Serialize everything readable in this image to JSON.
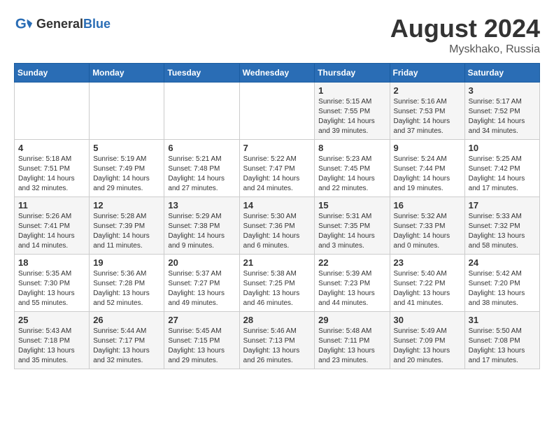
{
  "header": {
    "logo_general": "General",
    "logo_blue": "Blue",
    "title": "August 2024",
    "location": "Myskhako, Russia"
  },
  "weekdays": [
    "Sunday",
    "Monday",
    "Tuesday",
    "Wednesday",
    "Thursday",
    "Friday",
    "Saturday"
  ],
  "weeks": [
    [
      {
        "day": "",
        "info": ""
      },
      {
        "day": "",
        "info": ""
      },
      {
        "day": "",
        "info": ""
      },
      {
        "day": "",
        "info": ""
      },
      {
        "day": "1",
        "info": "Sunrise: 5:15 AM\nSunset: 7:55 PM\nDaylight: 14 hours\nand 39 minutes."
      },
      {
        "day": "2",
        "info": "Sunrise: 5:16 AM\nSunset: 7:53 PM\nDaylight: 14 hours\nand 37 minutes."
      },
      {
        "day": "3",
        "info": "Sunrise: 5:17 AM\nSunset: 7:52 PM\nDaylight: 14 hours\nand 34 minutes."
      }
    ],
    [
      {
        "day": "4",
        "info": "Sunrise: 5:18 AM\nSunset: 7:51 PM\nDaylight: 14 hours\nand 32 minutes."
      },
      {
        "day": "5",
        "info": "Sunrise: 5:19 AM\nSunset: 7:49 PM\nDaylight: 14 hours\nand 29 minutes."
      },
      {
        "day": "6",
        "info": "Sunrise: 5:21 AM\nSunset: 7:48 PM\nDaylight: 14 hours\nand 27 minutes."
      },
      {
        "day": "7",
        "info": "Sunrise: 5:22 AM\nSunset: 7:47 PM\nDaylight: 14 hours\nand 24 minutes."
      },
      {
        "day": "8",
        "info": "Sunrise: 5:23 AM\nSunset: 7:45 PM\nDaylight: 14 hours\nand 22 minutes."
      },
      {
        "day": "9",
        "info": "Sunrise: 5:24 AM\nSunset: 7:44 PM\nDaylight: 14 hours\nand 19 minutes."
      },
      {
        "day": "10",
        "info": "Sunrise: 5:25 AM\nSunset: 7:42 PM\nDaylight: 14 hours\nand 17 minutes."
      }
    ],
    [
      {
        "day": "11",
        "info": "Sunrise: 5:26 AM\nSunset: 7:41 PM\nDaylight: 14 hours\nand 14 minutes."
      },
      {
        "day": "12",
        "info": "Sunrise: 5:28 AM\nSunset: 7:39 PM\nDaylight: 14 hours\nand 11 minutes."
      },
      {
        "day": "13",
        "info": "Sunrise: 5:29 AM\nSunset: 7:38 PM\nDaylight: 14 hours\nand 9 minutes."
      },
      {
        "day": "14",
        "info": "Sunrise: 5:30 AM\nSunset: 7:36 PM\nDaylight: 14 hours\nand 6 minutes."
      },
      {
        "day": "15",
        "info": "Sunrise: 5:31 AM\nSunset: 7:35 PM\nDaylight: 14 hours\nand 3 minutes."
      },
      {
        "day": "16",
        "info": "Sunrise: 5:32 AM\nSunset: 7:33 PM\nDaylight: 14 hours\nand 0 minutes."
      },
      {
        "day": "17",
        "info": "Sunrise: 5:33 AM\nSunset: 7:32 PM\nDaylight: 13 hours\nand 58 minutes."
      }
    ],
    [
      {
        "day": "18",
        "info": "Sunrise: 5:35 AM\nSunset: 7:30 PM\nDaylight: 13 hours\nand 55 minutes."
      },
      {
        "day": "19",
        "info": "Sunrise: 5:36 AM\nSunset: 7:28 PM\nDaylight: 13 hours\nand 52 minutes."
      },
      {
        "day": "20",
        "info": "Sunrise: 5:37 AM\nSunset: 7:27 PM\nDaylight: 13 hours\nand 49 minutes."
      },
      {
        "day": "21",
        "info": "Sunrise: 5:38 AM\nSunset: 7:25 PM\nDaylight: 13 hours\nand 46 minutes."
      },
      {
        "day": "22",
        "info": "Sunrise: 5:39 AM\nSunset: 7:23 PM\nDaylight: 13 hours\nand 44 minutes."
      },
      {
        "day": "23",
        "info": "Sunrise: 5:40 AM\nSunset: 7:22 PM\nDaylight: 13 hours\nand 41 minutes."
      },
      {
        "day": "24",
        "info": "Sunrise: 5:42 AM\nSunset: 7:20 PM\nDaylight: 13 hours\nand 38 minutes."
      }
    ],
    [
      {
        "day": "25",
        "info": "Sunrise: 5:43 AM\nSunset: 7:18 PM\nDaylight: 13 hours\nand 35 minutes."
      },
      {
        "day": "26",
        "info": "Sunrise: 5:44 AM\nSunset: 7:17 PM\nDaylight: 13 hours\nand 32 minutes."
      },
      {
        "day": "27",
        "info": "Sunrise: 5:45 AM\nSunset: 7:15 PM\nDaylight: 13 hours\nand 29 minutes."
      },
      {
        "day": "28",
        "info": "Sunrise: 5:46 AM\nSunset: 7:13 PM\nDaylight: 13 hours\nand 26 minutes."
      },
      {
        "day": "29",
        "info": "Sunrise: 5:48 AM\nSunset: 7:11 PM\nDaylight: 13 hours\nand 23 minutes."
      },
      {
        "day": "30",
        "info": "Sunrise: 5:49 AM\nSunset: 7:09 PM\nDaylight: 13 hours\nand 20 minutes."
      },
      {
        "day": "31",
        "info": "Sunrise: 5:50 AM\nSunset: 7:08 PM\nDaylight: 13 hours\nand 17 minutes."
      }
    ]
  ]
}
